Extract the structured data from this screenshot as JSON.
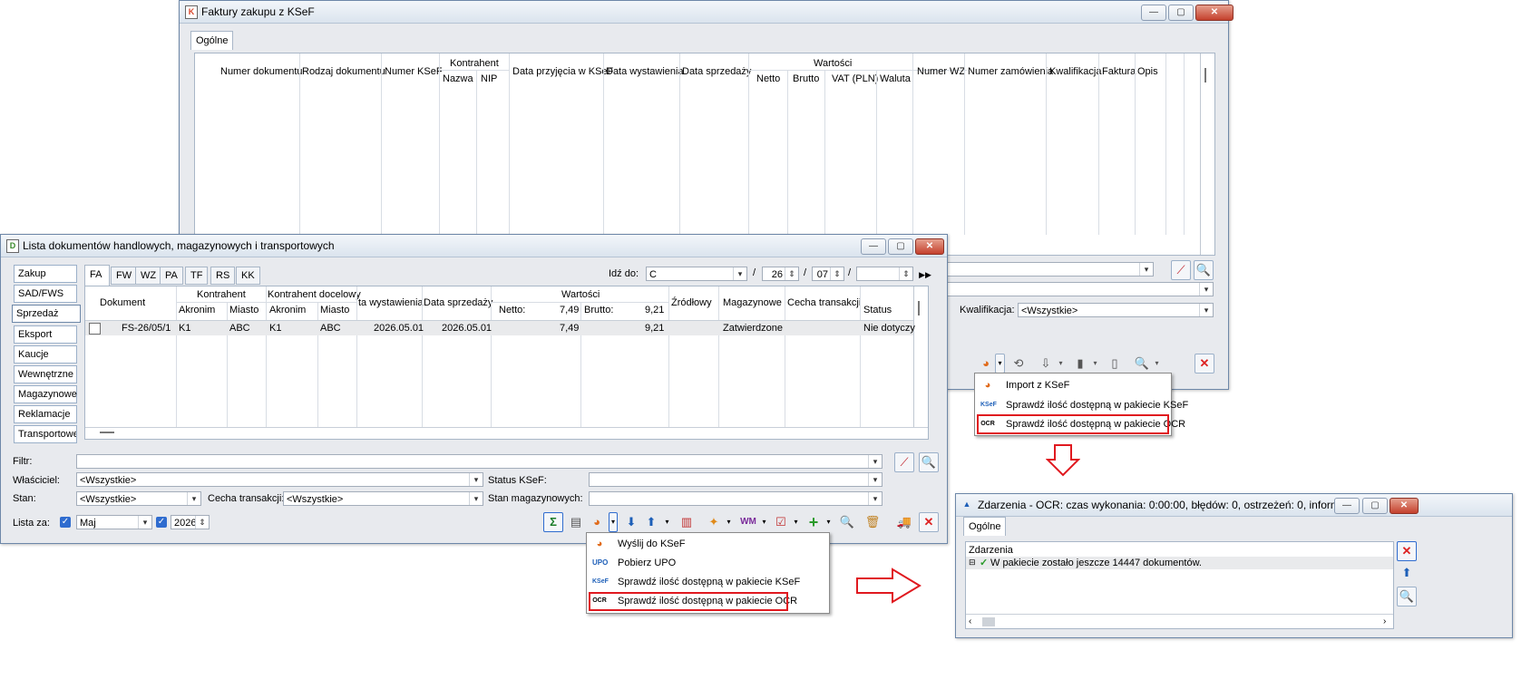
{
  "ksef_window": {
    "title": "Faktury zakupu z KSeF",
    "tab": "Ogólne",
    "columns": {
      "numer_dokumentu": "Numer dokumentu",
      "rodzaj_dokumentu": "Rodzaj dokumentu",
      "numer_ksef": "Numer KSeF",
      "kontrahent": "Kontrahent",
      "nazwa": "Nazwa",
      "nip": "NIP",
      "data_przyjecia": "Data przyjęcia w KSeF",
      "data_wystawienia": "Data wystawienia",
      "data_sprzedazy": "Data sprzedaży",
      "wartosci": "Wartości",
      "netto": "Netto",
      "brutto": "Brutto",
      "vat_pln": "VAT (PLN)",
      "waluta": "Waluta",
      "numer_wz": "Numer WZ",
      "numer_zamowienia": "Numer zamówienia",
      "kwalifikacja": "Kwalifikacja",
      "faktura": "Faktura",
      "opis": "Opis"
    },
    "kwalifikacja_label": "Kwalifikacja:",
    "kwalifikacja_value": "<Wszystkie>",
    "menu": {
      "import": "Import z KSeF",
      "sprawdz_ksef": "Sprawdź ilość dostępną w pakiecie KSeF",
      "sprawdz_ocr": "Sprawdź ilość dostępną w pakiecie OCR"
    }
  },
  "docs_window": {
    "title": "Lista dokumentów handlowych, magazynowych i transportowych",
    "side_tabs": [
      "Zakup",
      "SAD/FWS",
      "Sprzedaż",
      "Eksport",
      "Kaucje",
      "Wewnętrzne",
      "Magazynowe",
      "Reklamacje",
      "Transportowe"
    ],
    "doc_tabs": [
      "FA",
      "FW",
      "WZ",
      "PA",
      "TF",
      "RS",
      "KK"
    ],
    "idz_do_label": "Idź do:",
    "idz_do_value": "C",
    "date_day": "26",
    "date_month": "07",
    "columns": {
      "dokument": "Dokument",
      "kontrahent": "Kontrahent",
      "akronim": "Akronim",
      "miasto": "Miasto",
      "kontrahent_docelowy": "Kontrahent docelowy",
      "akronim2": "Akronim",
      "miasto2": "Miasto",
      "data_wystawienia": "ta wystawienia",
      "data_sprzedazy": "Data sprzedaży",
      "wartosci": "Wartości",
      "netto_lbl": "Netto:",
      "netto_sum": "7,49",
      "brutto_lbl": "Brutto:",
      "brutto_sum": "9,21",
      "zrodlowy": "Źródłowy",
      "magazynowe": "Magazynowe",
      "cecha": "Cecha transakcji",
      "status": "Status"
    },
    "row": {
      "dokument": "FS-26/05/1",
      "akronim": "K1",
      "miasto": "ABC",
      "akronim2": "K1",
      "miasto2": "ABC",
      "data_wystawienia": "2026.05.01",
      "data_sprzedazy": "2026.05.01",
      "netto": "7,49",
      "brutto": "9,21",
      "magazynowe": "Zatwierdzone",
      "status": "Nie dotyczy"
    },
    "filters": {
      "filtr": "Filtr:",
      "wlasciciel": "Właściciel:",
      "wlasciciel_value": "<Wszystkie>",
      "stan": "Stan:",
      "stan_value": "<Wszystkie>",
      "cecha": "Cecha transakcji:",
      "cecha_value": "<Wszystkie>",
      "status_ksef": "Status KSeF:",
      "stan_mag": "Stan magazynowych:",
      "lista_za": "Lista za:",
      "miesiac": "Maj",
      "rok": "2026"
    },
    "menu": {
      "wyslij": "Wyślij do KSeF",
      "upo": "Pobierz UPO",
      "sprawdz_ksef": "Sprawdź ilość dostępną w pakiecie KSeF",
      "sprawdz_ocr": "Sprawdź ilość dostępną w pakiecie OCR"
    },
    "colors": {
      "accent": "#2f6ccf",
      "highlight": "#e0191f"
    }
  },
  "events_window": {
    "title": "Zdarzenia - OCR: czas wykonania:  0:00:00, błędów: 0, ostrzeżeń: 0, informacji: ...",
    "tab": "Ogólne",
    "header": "Zdarzenia",
    "message": "W pakiecie zostało jeszcze 14447 dokumentów."
  }
}
